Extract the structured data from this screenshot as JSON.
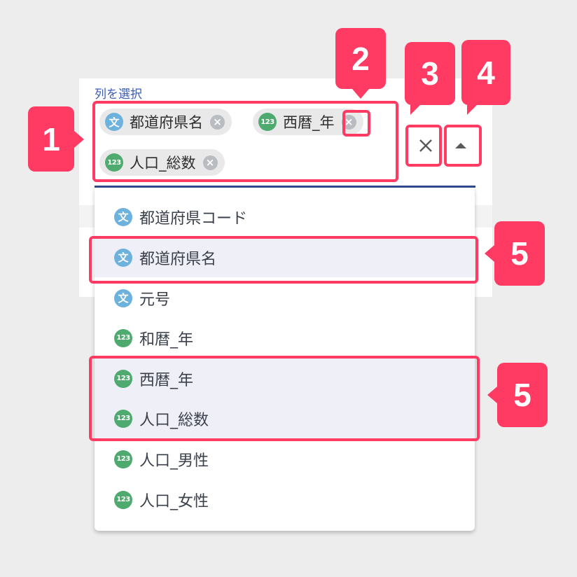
{
  "select": {
    "label": "列を選択",
    "chips": [
      {
        "type_icon": "文",
        "type": "text-type-icon",
        "label": "都道府県名"
      },
      {
        "type_icon": "123",
        "type": "number-type-icon",
        "label": "西暦_年"
      },
      {
        "type_icon": "123",
        "type": "number-type-icon",
        "label": "人口_総数"
      }
    ],
    "clear_icon": "×",
    "toggle_icon": "caret-up-icon"
  },
  "menu": {
    "options": [
      {
        "type_icon": "文",
        "label": "都道府県コード",
        "selected": false
      },
      {
        "type_icon": "文",
        "label": "都道府県名",
        "selected": true
      },
      {
        "type_icon": "文",
        "label": "元号",
        "selected": false
      },
      {
        "type_icon": "123",
        "label": "和暦_年",
        "selected": false
      },
      {
        "type_icon": "123",
        "label": "西暦_年",
        "selected": true
      },
      {
        "type_icon": "123",
        "label": "人口_総数",
        "selected": true
      },
      {
        "type_icon": "123",
        "label": "人口_男性",
        "selected": false
      },
      {
        "type_icon": "123",
        "label": "人口_女性",
        "selected": false
      }
    ]
  },
  "annotations": {
    "b1": "1",
    "b2": "2",
    "b3": "3",
    "b4": "4",
    "b5a": "5",
    "b5b": "5"
  },
  "colors": {
    "annotation": "#ff3a63",
    "text_type": "#6db1dd",
    "number_type": "#4eaa6e",
    "accent": "#3d5db5"
  }
}
